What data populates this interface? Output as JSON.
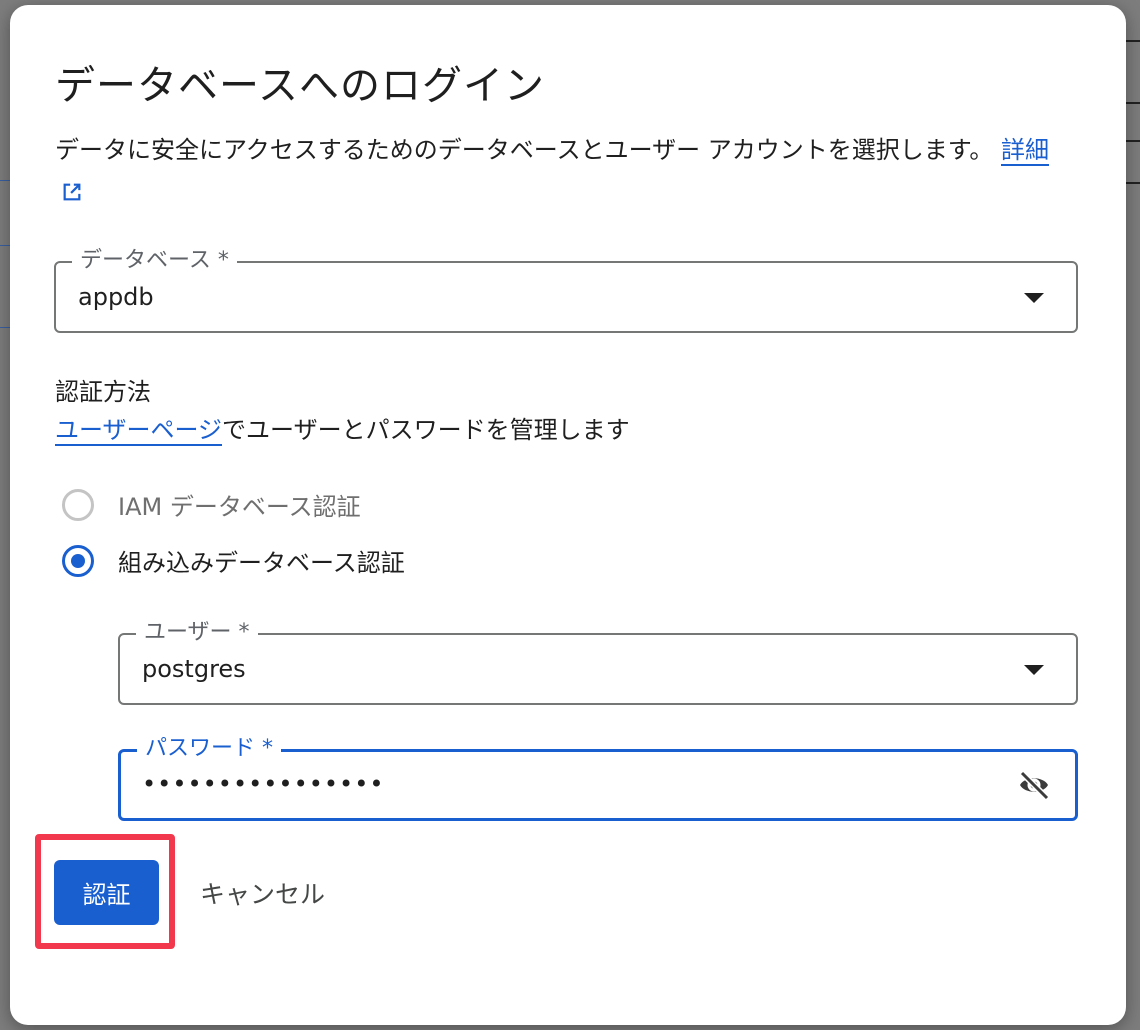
{
  "dialog": {
    "title": "データベースへのログイン",
    "description_text": "データに安全にアクセスするためのデータベースとユーザー アカウントを選択します。",
    "learn_more_label": "詳細",
    "database_field": {
      "label": "データベース *",
      "value": "appdb"
    },
    "auth_section": {
      "title": "認証方法",
      "users_page_link": "ユーザーページ",
      "users_page_suffix": "でユーザーとパスワードを管理します",
      "options": [
        {
          "label": "IAM データベース認証",
          "selected": false
        },
        {
          "label": "組み込みデータベース認証",
          "selected": true
        }
      ]
    },
    "user_field": {
      "label": "ユーザー *",
      "value": "postgres"
    },
    "password_field": {
      "label": "パスワード *",
      "value": "••••••••••••••••"
    },
    "buttons": {
      "authenticate_label": "認証",
      "cancel_label": "キャンセル"
    }
  },
  "colors": {
    "accent": "#1a5fd0",
    "highlight": "#f2384d",
    "surface": "#ffffff"
  },
  "icons": {
    "learn_more": "external-link-icon",
    "password_toggle": "visibility-off-icon",
    "select": "dropdown-arrow-icon"
  }
}
